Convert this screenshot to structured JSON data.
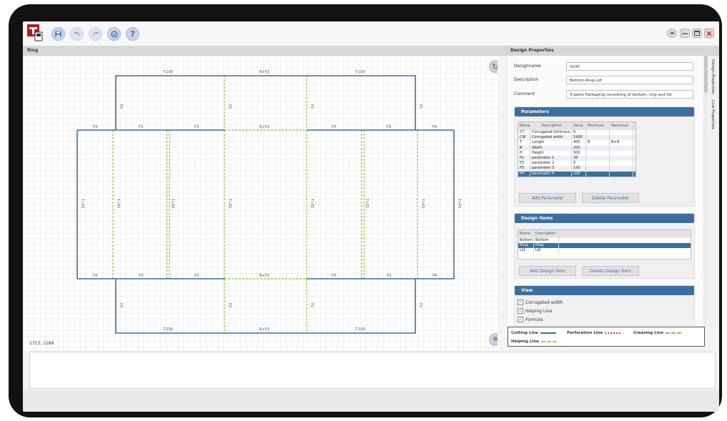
{
  "toolbar": {
    "icons": [
      "app-logo-icon",
      "save-icon",
      "undo-icon",
      "redo-icon",
      "check-icon",
      "help-icon"
    ],
    "help_glyph": "?",
    "window_controls": [
      "pin-icon",
      "minimize-icon",
      "maximize-icon",
      "close-icon"
    ]
  },
  "canvas": {
    "title": "Ring",
    "coords": "1713, 1189",
    "labels": {
      "t100": "T-100",
      "b_p1": "B+P1",
      "p2": "P2",
      "p3": "P3",
      "p4": "P4",
      "t_p2": "T+P2"
    }
  },
  "design": {
    "title": "Design Properties",
    "fields": [
      {
        "label": "Designname",
        "value": "0035"
      },
      {
        "label": "Description",
        "value": "Bottom-Ring-Lid"
      },
      {
        "label": "Comment",
        "value": "3-parts Packaging consisting of bottom, ring and lid"
      }
    ],
    "parameters": {
      "title": "Parameters",
      "columns": [
        "Name",
        "Description",
        "Value",
        "Minimum",
        "Maximum"
      ],
      "rows": [
        [
          "CT",
          "Corrugated thickness",
          "6",
          "",
          ""
        ],
        [
          "CW",
          "Corrugated width",
          "1900",
          "",
          ""
        ],
        [
          "T",
          "Length",
          "400",
          "B",
          "B+H"
        ],
        [
          "B",
          "Width",
          "200",
          "",
          ""
        ],
        [
          "H",
          "Height",
          "500",
          "",
          ""
        ],
        [
          "P1",
          "parameter 1",
          "26",
          "",
          ""
        ],
        [
          "P2",
          "parameter 2",
          "6",
          "",
          ""
        ],
        [
          "P3",
          "parameter 3",
          "150",
          "",
          ""
        ],
        [
          "P4",
          "parameter 4",
          "100",
          "",
          ""
        ]
      ],
      "add_label": "Add Parameter",
      "delete_label": "Delete Parameter"
    },
    "items": {
      "title": "Design Items",
      "columns": [
        "Name",
        "Description"
      ],
      "rows": [
        [
          "Bottom",
          "Bottom"
        ],
        [
          "Ring",
          "Ring"
        ],
        [
          "Lid",
          "Lid"
        ]
      ],
      "add_label": "Add Design Item",
      "delete_label": "Delete Design Item"
    },
    "view": {
      "title": "View",
      "options": [
        "Corrugated width",
        "Helping Line",
        "Formula"
      ],
      "check": "✓"
    }
  },
  "side_tabs": [
    "Design Properties",
    "Line Properties"
  ],
  "legend": {
    "cutting": "Cutting Line",
    "perforation": "Perforation Line",
    "creasing": "Creasing Line",
    "helping": "Helping Line"
  },
  "colors": {
    "cutting": "#3f6f97",
    "perforation": "#e23b3b",
    "creasing": "#86c440",
    "helping": "#f0b51c",
    "accent": "#3c6fa0"
  }
}
